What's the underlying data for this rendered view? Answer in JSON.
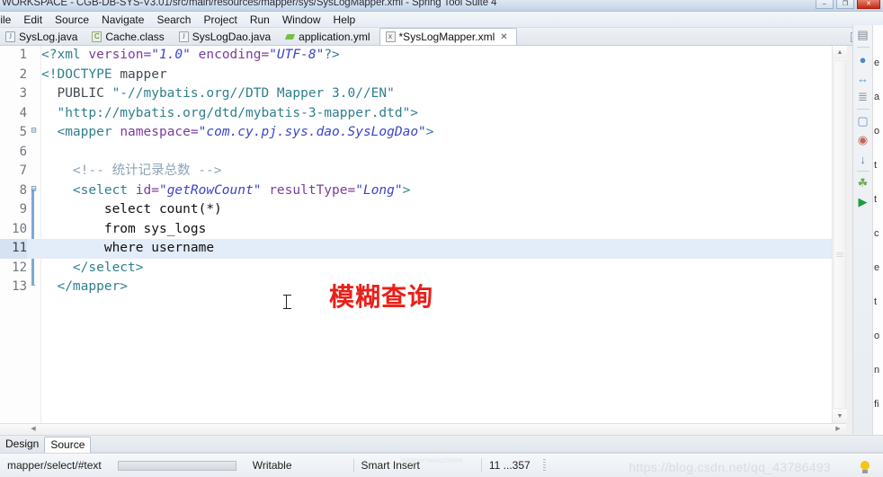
{
  "window": {
    "title": "WORKSPACE - CGB-DB-SYS-V3.01/src/main/resources/mapper/sys/SysLogMapper.xml - Spring Tool Suite 4",
    "minimize_label": "–",
    "maximize_label": "❐",
    "close_label": "✕"
  },
  "menubar": {
    "items": [
      {
        "label": "File"
      },
      {
        "label": "Edit"
      },
      {
        "label": "Source"
      },
      {
        "label": "Navigate"
      },
      {
        "label": "Search"
      },
      {
        "label": "Project"
      },
      {
        "label": "Run"
      },
      {
        "label": "Window"
      },
      {
        "label": "Help"
      }
    ]
  },
  "tabs": {
    "items": [
      {
        "label": "SysLog.java",
        "icon": "java-file-icon",
        "active": false,
        "dirty": false
      },
      {
        "label": "Cache.class",
        "icon": "class-file-icon",
        "active": false,
        "dirty": false
      },
      {
        "label": "SysLogDao.java",
        "icon": "java-file-icon",
        "active": false,
        "dirty": false
      },
      {
        "label": "application.yml",
        "icon": "yaml-file-icon",
        "active": false,
        "dirty": false
      },
      {
        "label": "*SysLogMapper.xml",
        "icon": "xml-file-icon",
        "active": true,
        "dirty": true,
        "close_label": "✕"
      }
    ],
    "minimize_label": "minimize",
    "maximize_label": "maximize"
  },
  "editor": {
    "lines": [
      {
        "num": "1",
        "folding": "",
        "current": false,
        "tokens": [
          {
            "t": "pi",
            "s": "<?"
          },
          {
            "t": "tag",
            "s": "xml "
          },
          {
            "t": "attr",
            "s": "version="
          },
          {
            "t": "val",
            "s": "\"1.0\""
          },
          {
            "t": "plain",
            "s": " "
          },
          {
            "t": "attr",
            "s": "encoding="
          },
          {
            "t": "val",
            "s": "\"UTF-8\""
          },
          {
            "t": "pi",
            "s": "?>"
          }
        ]
      },
      {
        "num": "2",
        "folding": "",
        "current": false,
        "tokens": [
          {
            "t": "tag",
            "s": "<!DOCTYPE "
          },
          {
            "t": "plain",
            "s": "mapper"
          }
        ]
      },
      {
        "num": "3",
        "folding": "",
        "current": false,
        "tokens": [
          {
            "t": "plain",
            "s": "  PUBLIC "
          },
          {
            "t": "tag",
            "s": "\"-//mybatis.org//DTD Mapper 3.0//EN\""
          }
        ]
      },
      {
        "num": "4",
        "folding": "",
        "current": false,
        "tokens": [
          {
            "t": "plain",
            "s": "  "
          },
          {
            "t": "tag",
            "s": "\"http://mybatis.org/dtd/mybatis-3-mapper.dtd\">"
          }
        ]
      },
      {
        "num": "5",
        "folding": "⊟",
        "current": false,
        "tokens": [
          {
            "t": "plain",
            "s": "  "
          },
          {
            "t": "tag",
            "s": "<mapper "
          },
          {
            "t": "attr",
            "s": "namespace="
          },
          {
            "t": "val",
            "s": "\"com.cy.pj.sys.dao.SysLogDao\""
          },
          {
            "t": "tag",
            "s": ">"
          }
        ]
      },
      {
        "num": "6",
        "folding": "",
        "current": false,
        "tokens": []
      },
      {
        "num": "7",
        "folding": "",
        "current": false,
        "tokens": [
          {
            "t": "cmt",
            "s": "    <!-- 统计记录总数 -->"
          }
        ]
      },
      {
        "num": "8",
        "folding": "⊟",
        "current": false,
        "tokens": [
          {
            "t": "plain",
            "s": "    "
          },
          {
            "t": "tag",
            "s": "<select "
          },
          {
            "t": "attr",
            "s": "id="
          },
          {
            "t": "val",
            "s": "\"getRowCount\""
          },
          {
            "t": "plain",
            "s": " "
          },
          {
            "t": "attr",
            "s": "resultType="
          },
          {
            "t": "val",
            "s": "\"Long\""
          },
          {
            "t": "tag",
            "s": ">"
          }
        ]
      },
      {
        "num": "9",
        "folding": "",
        "current": false,
        "tokens": [
          {
            "t": "txt",
            "s": "        select count(*)"
          }
        ]
      },
      {
        "num": "10",
        "folding": "",
        "current": false,
        "tokens": [
          {
            "t": "txt",
            "s": "        from sys_logs"
          }
        ]
      },
      {
        "num": "11",
        "folding": "",
        "current": true,
        "tokens": [
          {
            "t": "txt",
            "s": "        where username"
          }
        ]
      },
      {
        "num": "12",
        "folding": "",
        "current": false,
        "tokens": [
          {
            "t": "plain",
            "s": "    "
          },
          {
            "t": "tag",
            "s": "</select>"
          }
        ]
      },
      {
        "num": "13",
        "folding": "",
        "current": false,
        "tokens": [
          {
            "t": "plain",
            "s": "  "
          },
          {
            "t": "tag",
            "s": "</mapper>"
          }
        ]
      }
    ],
    "annotation": "模糊查询",
    "annotation_color": "#e8201a"
  },
  "rail": {
    "items": [
      {
        "name": "outline-icon",
        "glyph": "▤",
        "color": "#7b8794"
      },
      {
        "name": "link-editor-icon",
        "glyph": "●",
        "color": "#4b8bc8"
      },
      {
        "name": "collapse-all-icon",
        "glyph": "↔",
        "color": "#5a9fd4"
      },
      {
        "name": "sort-icon",
        "glyph": "≣",
        "color": "#8a939e"
      },
      {
        "name": "console-icon",
        "glyph": "▢",
        "color": "#6d8fb8"
      },
      {
        "name": "progress-icon",
        "glyph": "◉",
        "color": "#c0655a"
      },
      {
        "name": "download-icon",
        "glyph": "↓",
        "color": "#5f7fa8"
      },
      {
        "name": "boot-dashboard-icon",
        "glyph": "☘",
        "color": "#6aa84f"
      },
      {
        "name": "run-icon",
        "glyph": "▶",
        "color": "#1e9e3e"
      }
    ]
  },
  "cutpanel": {
    "fragments": [
      "e",
      "a",
      "o",
      "t",
      "t",
      "c",
      "e",
      "t",
      "o",
      "n",
      "fi"
    ]
  },
  "bottom_tabs": {
    "items": [
      {
        "label": "Design",
        "active": false
      },
      {
        "label": "Source",
        "active": true
      }
    ]
  },
  "statusbar": {
    "breadcrumb": "mapper/select/#text",
    "writable": "Writable",
    "insert_mode": "Smart Insert",
    "position": "11 ...357",
    "watermark": "https://blog.csdn.net/qq_43786493",
    "watermark_small": "mapper/select/#text"
  }
}
